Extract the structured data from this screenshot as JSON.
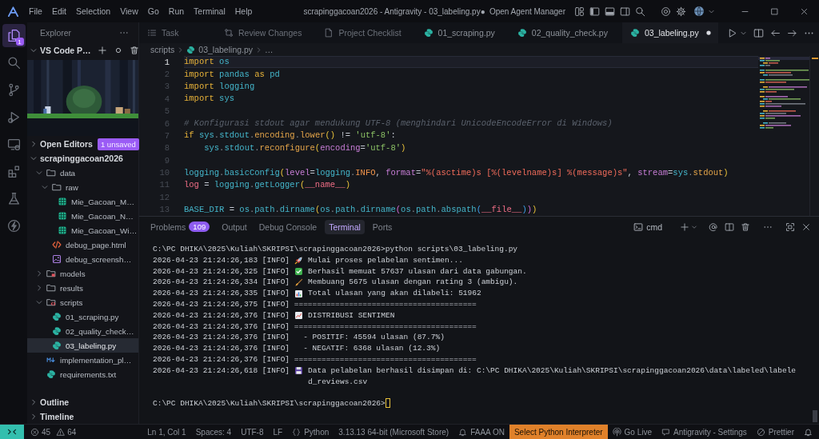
{
  "title_bar": {
    "menu": [
      "File",
      "Edit",
      "Selection",
      "View",
      "Go",
      "Run",
      "Terminal",
      "Help"
    ],
    "title": "scrapinggacoan2026 - Antigravity - 03_labeling.py●",
    "agent_button": "Open Agent Manager"
  },
  "activity_bar": [
    {
      "kind": "explorer",
      "selected": true,
      "badge": "1"
    },
    {
      "kind": "search",
      "selected": false
    },
    {
      "kind": "source-control",
      "selected": false
    },
    {
      "kind": "run-debug",
      "selected": false
    },
    {
      "kind": "remote",
      "selected": false
    },
    {
      "kind": "extensions",
      "selected": false
    },
    {
      "kind": "testing",
      "selected": false
    },
    {
      "kind": "lightning",
      "selected": false
    }
  ],
  "sidebar": {
    "title": "Explorer",
    "sections": [
      {
        "kind": "pets",
        "title": "VS Code P…",
        "expanded": true
      },
      {
        "kind": "header",
        "title": "Open Editors",
        "expanded": false,
        "badge": "1 unsaved"
      },
      {
        "kind": "folder",
        "title": "scrapinggacoan2026",
        "expanded": true,
        "children": [
          {
            "kind": "folder",
            "name": "data",
            "expanded": true,
            "selected": false,
            "children": [
              {
                "kind": "folder",
                "name": "raw",
                "expanded": true,
                "selected": false,
                "children": [
                  {
                    "kind": "sheet",
                    "name": "Mie_Gacoan_M…",
                    "selected": false
                  },
                  {
                    "kind": "sheet",
                    "name": "Mie_Gacoan_N…",
                    "selected": false
                  },
                  {
                    "kind": "sheet",
                    "name": "Mie_Gacoan_Wi…",
                    "selected": false
                  }
                ]
              },
              {
                "kind": "html",
                "name": "debug_page.html",
                "selected": false
              },
              {
                "kind": "image",
                "name": "debug_screensh…",
                "selected": false
              }
            ]
          },
          {
            "kind": "model-folder",
            "name": "models",
            "expanded": false,
            "selected": false
          },
          {
            "kind": "folder",
            "name": "results",
            "expanded": false,
            "selected": false
          },
          {
            "kind": "script-folder",
            "name": "scripts",
            "expanded": true,
            "selected": false,
            "children": [
              {
                "kind": "python",
                "name": "01_scraping.py",
                "selected": false
              },
              {
                "kind": "python",
                "name": "02_quality_check…",
                "selected": false
              },
              {
                "kind": "python",
                "name": "03_labeling.py",
                "selected": true
              }
            ]
          },
          {
            "kind": "markdown",
            "name": "implementation_pl…",
            "selected": false
          },
          {
            "kind": "python",
            "name": "requirements.txt",
            "selected": false
          }
        ]
      },
      {
        "kind": "header",
        "title": "Outline",
        "expanded": false
      },
      {
        "kind": "header",
        "title": "Timeline",
        "expanded": false
      }
    ]
  },
  "editor": {
    "tabs": [
      {
        "kind": "task",
        "label": "Task",
        "selected": false,
        "modified": false
      },
      {
        "kind": "review",
        "label": "Review Changes",
        "selected": false,
        "modified": false
      },
      {
        "kind": "document",
        "label": "Project Checklist",
        "selected": false,
        "modified": false
      },
      {
        "kind": "python",
        "label": "01_scraping.py",
        "selected": false,
        "modified": false
      },
      {
        "kind": "python",
        "label": "02_quality_check.py",
        "selected": false,
        "modified": false
      },
      {
        "kind": "python",
        "label": "03_labeling.py",
        "selected": true,
        "modified": true
      }
    ],
    "breadcrumb": [
      {
        "kind": "folder",
        "label": "scripts"
      },
      {
        "kind": "python",
        "label": "03_labeling.py"
      },
      {
        "kind": "symbol",
        "label": "…"
      }
    ],
    "lines": [
      {
        "number": "1",
        "current": true,
        "tokens": [
          {
            "kind": "keyword",
            "text": "import "
          },
          {
            "kind": "module",
            "text": "os"
          }
        ]
      },
      {
        "number": "2",
        "current": false,
        "tokens": [
          {
            "kind": "keyword",
            "text": "import "
          },
          {
            "kind": "module",
            "text": "pandas "
          },
          {
            "kind": "keyword",
            "text": "as "
          },
          {
            "kind": "module",
            "text": "pd"
          }
        ]
      },
      {
        "number": "3",
        "current": false,
        "tokens": [
          {
            "kind": "keyword",
            "text": "import "
          },
          {
            "kind": "module",
            "text": "logging"
          }
        ]
      },
      {
        "number": "4",
        "current": false,
        "tokens": [
          {
            "kind": "keyword",
            "text": "import "
          },
          {
            "kind": "module",
            "text": "sys"
          }
        ]
      },
      {
        "number": "5",
        "current": false
      },
      {
        "number": "6",
        "current": false,
        "tokens": [
          {
            "kind": "comment",
            "text": "# Konfigurasi stdout agar mendukung UTF-8 (menghindari UnicodeEncodeError di Windows)"
          }
        ]
      },
      {
        "number": "7",
        "current": false,
        "tokens": [
          {
            "kind": "keyword",
            "text": "if "
          },
          {
            "kind": "module",
            "text": "sys"
          },
          {
            "kind": "punct",
            "text": "."
          },
          {
            "kind": "module",
            "text": "stdout"
          },
          {
            "kind": "punct",
            "text": "."
          },
          {
            "kind": "attr",
            "text": "encoding"
          },
          {
            "kind": "punct",
            "text": "."
          },
          {
            "kind": "attr",
            "text": "lower"
          },
          {
            "kind": "bracket",
            "text": "()"
          },
          {
            "kind": "plain",
            "text": " != "
          },
          {
            "kind": "string",
            "text": "'utf-8'"
          },
          {
            "kind": "plain",
            "text": ":"
          }
        ]
      },
      {
        "number": "8",
        "current": false,
        "tokens": [
          {
            "kind": "module",
            "text": "    sys"
          },
          {
            "kind": "punct",
            "text": "."
          },
          {
            "kind": "module",
            "text": "stdout"
          },
          {
            "kind": "punct",
            "text": "."
          },
          {
            "kind": "attr",
            "text": "reconfigure"
          },
          {
            "kind": "bracket",
            "text": "("
          },
          {
            "kind": "param",
            "text": "encoding"
          },
          {
            "kind": "plain",
            "text": "="
          },
          {
            "kind": "string",
            "text": "'utf-8'"
          },
          {
            "kind": "bracket",
            "text": ")"
          }
        ]
      },
      {
        "number": "9",
        "current": false
      },
      {
        "number": "10",
        "current": false,
        "tokens": [
          {
            "kind": "module",
            "text": "logging"
          },
          {
            "kind": "punct",
            "text": "."
          },
          {
            "kind": "module",
            "text": "basicConfig"
          },
          {
            "kind": "bracket",
            "text": "("
          },
          {
            "kind": "param",
            "text": "level"
          },
          {
            "kind": "plain",
            "text": "="
          },
          {
            "kind": "module",
            "text": "logging"
          },
          {
            "kind": "punct",
            "text": "."
          },
          {
            "kind": "const",
            "text": "INFO"
          },
          {
            "kind": "plain",
            "text": ", "
          },
          {
            "kind": "param",
            "text": "format"
          },
          {
            "kind": "plain",
            "text": "="
          },
          {
            "kind": "fstring",
            "text": "\"%(asctime)s [%(levelname)s] %(message)s\""
          },
          {
            "kind": "plain",
            "text": ", "
          },
          {
            "kind": "param",
            "text": "stream"
          },
          {
            "kind": "plain",
            "text": "="
          },
          {
            "kind": "module",
            "text": "sys"
          },
          {
            "kind": "punct",
            "text": "."
          },
          {
            "kind": "attr",
            "text": "stdout"
          },
          {
            "kind": "bracket",
            "text": ")"
          }
        ]
      },
      {
        "number": "11",
        "current": false,
        "tokens": [
          {
            "kind": "var",
            "text": "log"
          },
          {
            "kind": "plain",
            "text": " = "
          },
          {
            "kind": "module",
            "text": "logging"
          },
          {
            "kind": "punct",
            "text": "."
          },
          {
            "kind": "module",
            "text": "getLogger"
          },
          {
            "kind": "bracket",
            "text": "("
          },
          {
            "kind": "var",
            "text": "__name__"
          },
          {
            "kind": "bracket",
            "text": ")"
          }
        ]
      },
      {
        "number": "12",
        "current": false
      },
      {
        "number": "13",
        "current": false,
        "tokens": [
          {
            "kind": "module",
            "text": "BASE_DIR"
          },
          {
            "kind": "plain",
            "text": " = "
          },
          {
            "kind": "module",
            "text": "os"
          },
          {
            "kind": "punct",
            "text": "."
          },
          {
            "kind": "module",
            "text": "path"
          },
          {
            "kind": "punct",
            "text": "."
          },
          {
            "kind": "module",
            "text": "dirname"
          },
          {
            "kind": "bracket",
            "text": "("
          },
          {
            "kind": "module",
            "text": "os"
          },
          {
            "kind": "punct",
            "text": "."
          },
          {
            "kind": "module",
            "text": "path"
          },
          {
            "kind": "punct",
            "text": "."
          },
          {
            "kind": "module",
            "text": "dirname"
          },
          {
            "kind": "bracket2",
            "text": "("
          },
          {
            "kind": "module",
            "text": "os"
          },
          {
            "kind": "punct",
            "text": "."
          },
          {
            "kind": "module",
            "text": "path"
          },
          {
            "kind": "punct",
            "text": "."
          },
          {
            "kind": "module",
            "text": "abspath"
          },
          {
            "kind": "bracket3",
            "text": "("
          },
          {
            "kind": "var",
            "text": "__file__"
          },
          {
            "kind": "bracket3",
            "text": ")"
          },
          {
            "kind": "bracket2",
            "text": ")"
          },
          {
            "kind": "bracket",
            "text": ")"
          }
        ]
      }
    ]
  },
  "panel": {
    "tabs": [
      {
        "label": "Problems",
        "badge": "109",
        "selected": false
      },
      {
        "label": "Output",
        "selected": false
      },
      {
        "label": "Debug Console",
        "selected": false
      },
      {
        "label": "Terminal",
        "selected": true
      },
      {
        "label": "Ports",
        "selected": false
      }
    ],
    "profile": "cmd",
    "terminal": [
      {
        "kind": "prompt",
        "text": "C:\\PC DHIKA\\2025\\Kuliah\\SKRIPSI\\scrapinggacoan2026>python scripts\\03_labeling.py"
      },
      {
        "kind": "rocket",
        "text": "2026-04-23 21:24:26,183 [INFO]",
        "message": "Mulai proses pelabelan sentimen..."
      },
      {
        "kind": "check",
        "text": "2026-04-23 21:24:26,325 [INFO]",
        "message": "Berhasil memuat 57637 ulasan dari data gabungan."
      },
      {
        "kind": "broom",
        "text": "2026-04-23 21:24:26,334 [INFO]",
        "message": "Membuang 5675 ulasan dengan rating 3 (ambigu)."
      },
      {
        "kind": "chart",
        "text": "2026-04-23 21:24:26,335 [INFO]",
        "message": "Total ulasan yang akan dilabeli: 51962"
      },
      {
        "kind": "plain",
        "text": "2026-04-23 21:24:26,375 [INFO] ========================================"
      },
      {
        "kind": "trend",
        "text": "2026-04-23 21:24:26,376 [INFO]",
        "message": "DISTRIBUSI SENTIMEN"
      },
      {
        "kind": "plain",
        "text": "2026-04-23 21:24:26,376 [INFO] ========================================"
      },
      {
        "kind": "plain",
        "text": "2026-04-23 21:24:26,376 [INFO]   - POSITIF: 45594 ulasan (87.7%)"
      },
      {
        "kind": "plain",
        "text": "2026-04-23 21:24:26,376 [INFO]   - NEGATIF: 6368 ulasan (12.3%)"
      },
      {
        "kind": "plain",
        "text": "2026-04-23 21:24:26,376 [INFO] ========================================"
      },
      {
        "kind": "disk",
        "text": "2026-04-23 21:24:26,618 [INFO]",
        "message": "Data pelabelan berhasil disimpan di: C:\\PC DHIKA\\2025\\Kuliah\\SKRIPSI\\scrapinggacoan2026\\data\\labeled\\labeled_reviews.csv"
      },
      {
        "kind": "input",
        "text": "C:\\PC DHIKA\\2025\\Kuliah\\SKRIPSI\\scrapinggacoan2026>"
      }
    ]
  },
  "status_bar": {
    "left": [
      {
        "kind": "remote"
      },
      {
        "kind": "problems",
        "errors": "45",
        "warnings": "64"
      }
    ],
    "right": [
      {
        "kind": "text",
        "label": "Ln 1, Col 1"
      },
      {
        "kind": "text",
        "label": "Spaces: 4"
      },
      {
        "kind": "text",
        "label": "UTF-8"
      },
      {
        "kind": "text",
        "label": "LF"
      },
      {
        "kind": "braces",
        "label": "Python"
      },
      {
        "kind": "text",
        "label": "3.13.13 64-bit (Microsoft Store)"
      },
      {
        "kind": "bell",
        "label": "FAAA ON"
      },
      {
        "kind": "highlight",
        "label": "Select Python Interpreter"
      },
      {
        "kind": "broadcast",
        "label": "Go Live"
      },
      {
        "kind": "agent",
        "label": "Antigravity - Settings"
      },
      {
        "kind": "blocked",
        "label": "Prettier"
      },
      {
        "kind": "notifications"
      }
    ]
  }
}
